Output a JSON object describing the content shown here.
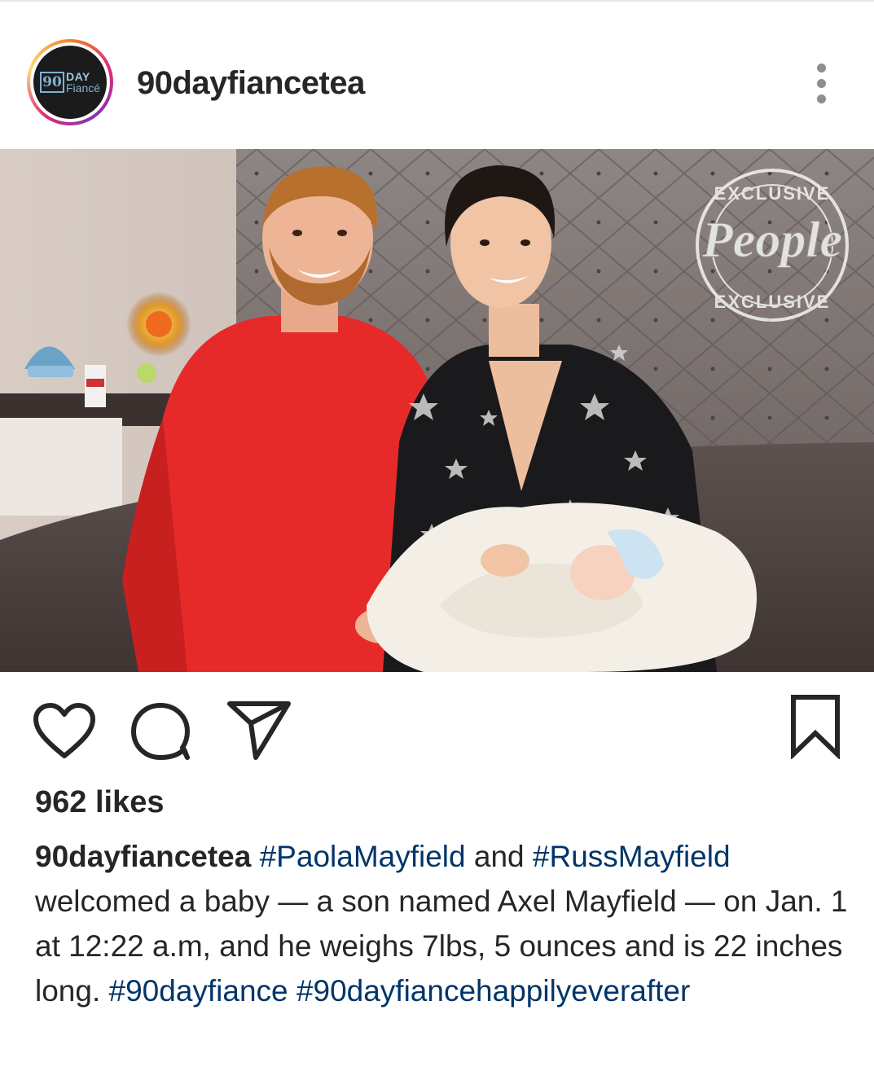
{
  "post": {
    "username": "90dayfiancetea",
    "avatar": {
      "logo_number": "90",
      "logo_day": "DAY",
      "logo_fiance": "Fiancé"
    },
    "photo": {
      "watermark_top": "EXCLUSIVE",
      "watermark_brand": "People",
      "watermark_bottom": "EXCLUSIVE"
    },
    "actions": {
      "like_icon": "heart-outline-icon",
      "comment_icon": "speech-bubble-icon",
      "share_icon": "paper-plane-icon",
      "save_icon": "bookmark-icon"
    },
    "likes_text": "962 likes",
    "caption": {
      "username": "90dayfiancetea",
      "tag1": "#PaolaMayfield",
      "text1": "and",
      "tag2": "#RussMayfield",
      "text2": "welcomed a baby — a son named Axel Mayfield — on Jan. 1 at 12:22 a.m, and he weighs 7lbs, 5 ounces and is 22 inches long.",
      "tag3": "#90dayfiance",
      "tag4": "#90dayfiancehappilyeverafter"
    }
  },
  "colors": {
    "text": "#262626",
    "hashtag": "#003569",
    "icon": "#262626",
    "muted": "#8e8e8e"
  }
}
